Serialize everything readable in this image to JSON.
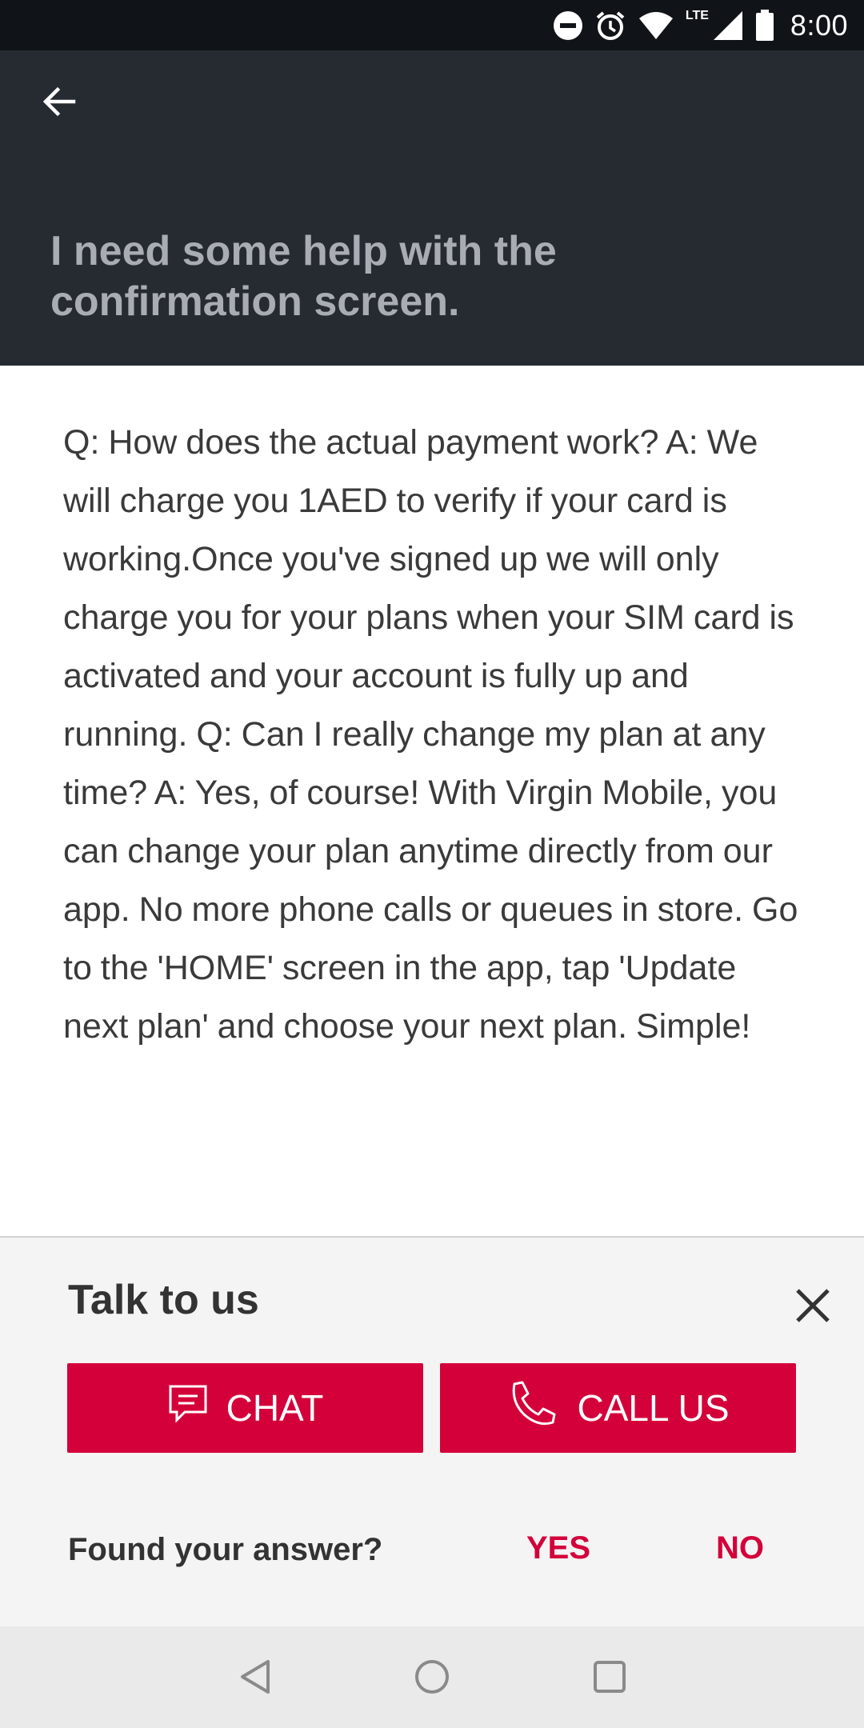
{
  "status_bar": {
    "time": "8:00",
    "network": "LTE",
    "icons": [
      "do-not-disturb-icon",
      "alarm-icon",
      "wifi-icon",
      "signal-icon",
      "battery-icon"
    ]
  },
  "header": {
    "back_icon": "arrow-left-icon",
    "title": "I need some help with the confirmation screen."
  },
  "content": {
    "answer": "Q:  How does the actual payment work? A: We will charge you 1AED to verify if your card is working.Once you've signed up we will only charge you for your plans when your SIM card is activated and your account is fully up and running. Q: Can I really change my plan at any time? A: Yes, of course! With Virgin Mobile, you can change your plan anytime directly from our app. No more phone calls or queues in store. Go to the 'HOME' screen in the app, tap 'Update next plan' and choose your next plan. Simple!"
  },
  "talk_panel": {
    "title": "Talk to us",
    "close_icon": "close-icon",
    "chat_label": "CHAT",
    "call_label": "CALL US",
    "found_label": "Found your answer?",
    "yes_label": "YES",
    "no_label": "NO"
  },
  "colors": {
    "header_bg": "#262b32",
    "status_bg": "#101418",
    "accent": "#d4003a",
    "panel_bg": "#f4f4f4",
    "nav_bg": "#eaeaea"
  }
}
